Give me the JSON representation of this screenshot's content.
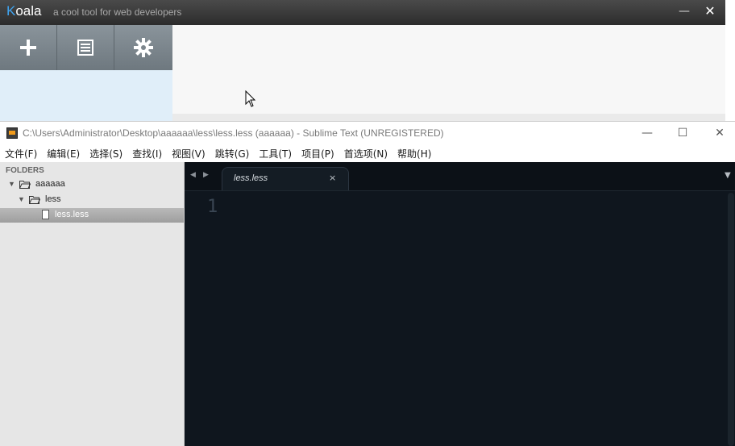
{
  "koala": {
    "logo_k": "K",
    "logo_rest": "oala",
    "tagline": "a cool tool for web developers",
    "minimize_glyph": "—",
    "close_glyph": "✕",
    "toolbar": {
      "add_icon": "plus-icon",
      "log_icon": "document-icon",
      "settings_icon": "gear-icon"
    }
  },
  "sublime": {
    "title": "C:\\Users\\Administrator\\Desktop\\aaaaaa\\less\\less.less (aaaaaa) - Sublime Text (UNREGISTERED)",
    "window_controls": {
      "minimize": "—",
      "maximize": "☐",
      "close": "✕"
    },
    "menu": [
      "文件(F)",
      "编辑(E)",
      "选择(S)",
      "查找(I)",
      "视图(V)",
      "跳转(G)",
      "工具(T)",
      "项目(P)",
      "首选项(N)",
      "帮助(H)"
    ],
    "sidebar": {
      "header": "FOLDERS",
      "tree": {
        "root": "aaaaaa",
        "subfolder": "less",
        "file": "less.less"
      }
    },
    "tabs": [
      {
        "label": "less.less",
        "close_glyph": "×"
      }
    ],
    "gutter": {
      "line_1": "1"
    },
    "nav": {
      "prev": "◀",
      "next": "▶",
      "dropdown": "▼"
    }
  }
}
